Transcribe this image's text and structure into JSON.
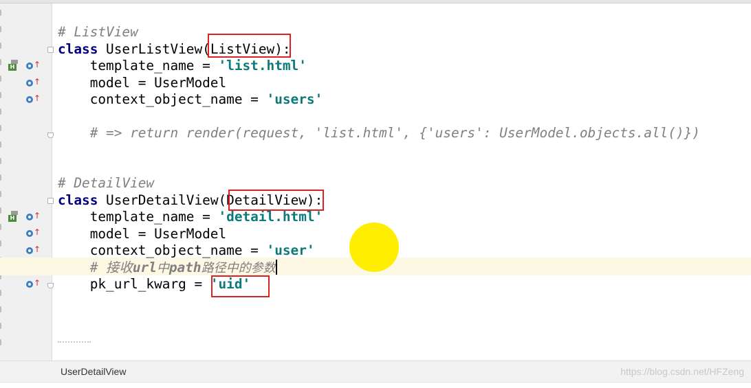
{
  "editor": {
    "lines": {
      "l1": {
        "comment": "# ListView"
      },
      "l2": {
        "kw": "class",
        "pre": " UserListView(",
        "base": "ListView",
        "post": "):"
      },
      "l3": {
        "pre": "    template_name = ",
        "str": "'list.html'"
      },
      "l4": {
        "text": "    model = UserModel"
      },
      "l5": {
        "pre": "    context_object_name = ",
        "str": "'users'"
      },
      "l6": {
        "comment": "    # => return render(request, 'list.html', {'users': UserModel.objects.all()})"
      },
      "l7": {
        "comment": "# DetailView"
      },
      "l8": {
        "kw": "class",
        "pre": " UserDetailView(",
        "base": "DetailView",
        "post": "):"
      },
      "l9": {
        "pre": "    template_name = ",
        "str": "'detail.html'"
      },
      "l10": {
        "text": "    model = UserModel"
      },
      "l11": {
        "pre": "    context_object_name = ",
        "str": "'user'"
      },
      "l12": {
        "indent": "    ",
        "cmt_a": "# 接收",
        "cmt_b": "url",
        "cmt_c": "中",
        "cmt_d": "path",
        "cmt_e": "路径中的参数"
      },
      "l13": {
        "pre": "    pk_url_kwarg = ",
        "str": "'uid'"
      }
    },
    "highlight_color": "#e02020"
  },
  "gutter_icons": {
    "implements": "overrides-method-icon",
    "hierarchy": "class-hierarchy-icon",
    "fold": "fold-marker-icon"
  },
  "status": {
    "breadcrumb": "UserDetailView",
    "watermark": "https://blog.csdn.net/HFZeng"
  }
}
